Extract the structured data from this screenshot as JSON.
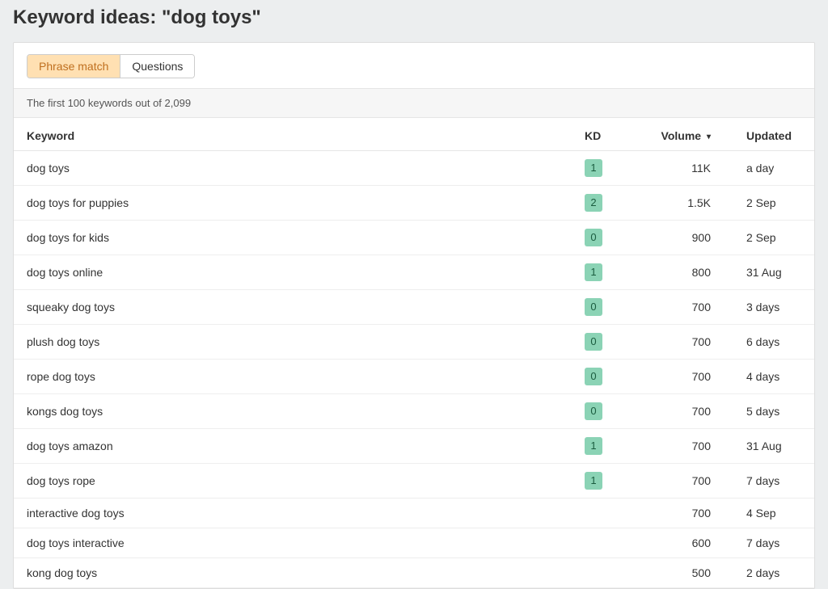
{
  "page_title": "Keyword ideas: \"dog toys\"",
  "tabs": {
    "phrase_match": "Phrase match",
    "questions": "Questions"
  },
  "info_bar": "The first 100 keywords out of 2,099",
  "columns": {
    "keyword": "Keyword",
    "kd": "KD",
    "volume": "Volume",
    "updated": "Updated"
  },
  "sort_indicator": "▾",
  "rows": [
    {
      "keyword": "dog toys",
      "kd": "1",
      "volume": "11K",
      "updated": "a day"
    },
    {
      "keyword": "dog toys for puppies",
      "kd": "2",
      "volume": "1.5K",
      "updated": "2 Sep"
    },
    {
      "keyword": "dog toys for kids",
      "kd": "0",
      "volume": "900",
      "updated": "2 Sep"
    },
    {
      "keyword": "dog toys online",
      "kd": "1",
      "volume": "800",
      "updated": "31 Aug"
    },
    {
      "keyword": "squeaky dog toys",
      "kd": "0",
      "volume": "700",
      "updated": "3 days"
    },
    {
      "keyword": "plush dog toys",
      "kd": "0",
      "volume": "700",
      "updated": "6 days"
    },
    {
      "keyword": "rope dog toys",
      "kd": "0",
      "volume": "700",
      "updated": "4 days"
    },
    {
      "keyword": "kongs dog toys",
      "kd": "0",
      "volume": "700",
      "updated": "5 days"
    },
    {
      "keyword": "dog toys amazon",
      "kd": "1",
      "volume": "700",
      "updated": "31 Aug"
    },
    {
      "keyword": "dog toys rope",
      "kd": "1",
      "volume": "700",
      "updated": "7 days"
    },
    {
      "keyword": "interactive dog toys",
      "kd": "",
      "volume": "700",
      "updated": "4 Sep"
    },
    {
      "keyword": "dog toys interactive",
      "kd": "",
      "volume": "600",
      "updated": "7 days"
    },
    {
      "keyword": "kong dog toys",
      "kd": "",
      "volume": "500",
      "updated": "2 days"
    }
  ]
}
